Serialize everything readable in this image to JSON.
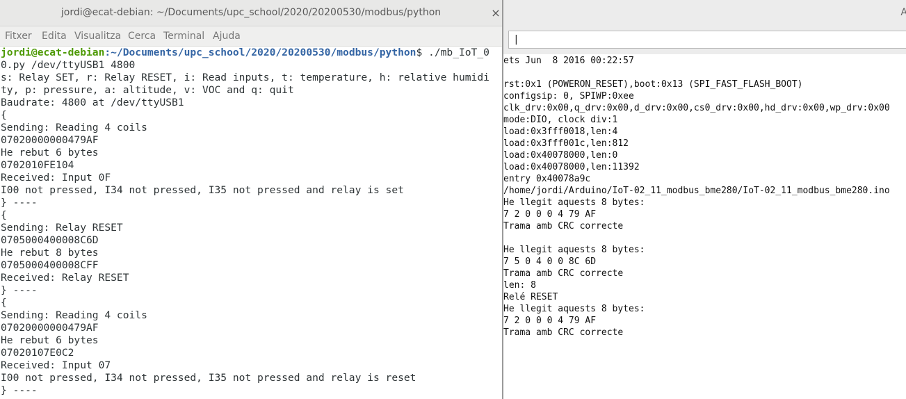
{
  "terminal": {
    "title": "jordi@ecat-debian: ~/Documents/upc_school/2020/20200530/modbus/python",
    "close_glyph": "×",
    "menu": [
      "Fitxer",
      "Edita",
      "Visualitza",
      "Cerca",
      "Terminal",
      "Ajuda"
    ],
    "prompt": {
      "user_host": "jordi@ecat-debian",
      "path": ":~/Documents/upc_school/2020/20200530/modbus/python",
      "command": "$ ./mb_IoT_0"
    },
    "lines": [
      "0.py /dev/ttyUSB1 4800",
      "s: Relay SET, r: Relay RESET, i: Read inputs, t: temperature, h: relative humidi",
      "ty, p: pressure, a: altitude, v: VOC and q: quit",
      "Baudrate: 4800 at /dev/ttyUSB1",
      "{",
      "Sending: Reading 4 coils",
      "07020000000479AF",
      "He rebut 6 bytes",
      "0702010FE104",
      "Received: Input 0F",
      "I00 not pressed, I34 not pressed, I35 not pressed and relay is set",
      "} ----",
      "{",
      "Sending: Relay RESET",
      "0705000400008C6D",
      "He rebut 8 bytes",
      "0705000400008CFF",
      "Received: Relay RESET",
      "} ----",
      "{",
      "Sending: Reading 4 coils",
      "07020000000479AF",
      "He rebut 6 bytes",
      "07020107E0C2",
      "Received: Input 07",
      "I00 not pressed, I34 not pressed, I35 not pressed and relay is reset",
      "} ----"
    ]
  },
  "serial_monitor": {
    "corner_glyph": "A",
    "input_value": "|",
    "lines": [
      "ets Jun  8 2016 00:22:57",
      "",
      "rst:0x1 (POWERON_RESET),boot:0x13 (SPI_FAST_FLASH_BOOT)",
      "configsip: 0, SPIWP:0xee",
      "clk_drv:0x00,q_drv:0x00,d_drv:0x00,cs0_drv:0x00,hd_drv:0x00,wp_drv:0x00",
      "mode:DIO, clock div:1",
      "load:0x3fff0018,len:4",
      "load:0x3fff001c,len:812",
      "load:0x40078000,len:0",
      "load:0x40078000,len:11392",
      "entry 0x40078a9c",
      "/home/jordi/Arduino/IoT-02_11_modbus_bme280/IoT-02_11_modbus_bme280.ino",
      "He llegit aquests 8 bytes:",
      "7 2 0 0 0 4 79 AF",
      "Trama amb CRC correcte",
      "",
      "He llegit aquests 8 bytes:",
      "7 5 0 4 0 0 8C 6D",
      "Trama amb CRC correcte",
      "len: 8",
      "Relé RESET",
      "He llegit aquests 8 bytes:",
      "7 2 0 0 0 4 79 AF",
      "Trama amb CRC correcte"
    ]
  }
}
